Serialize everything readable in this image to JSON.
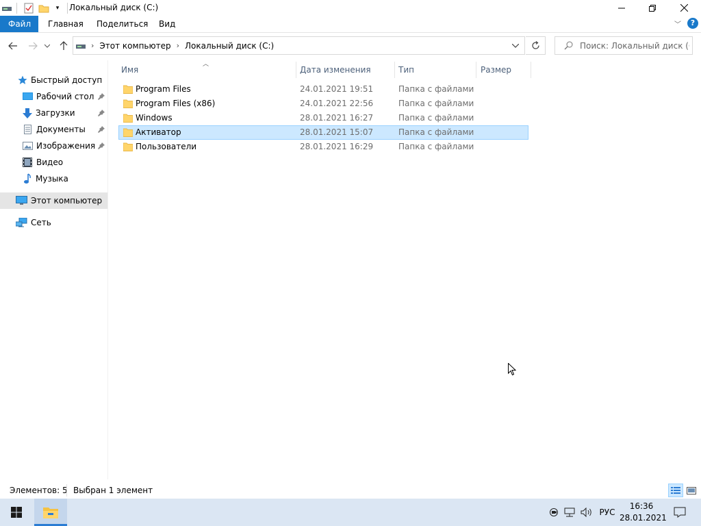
{
  "window": {
    "title": "Локальный диск (C:)",
    "minimize_icon": "minimize-icon",
    "restore_icon": "restore-icon",
    "close_icon": "close-icon"
  },
  "ribbon": {
    "tabs": [
      {
        "label": "Файл",
        "active": true
      },
      {
        "label": "Главная"
      },
      {
        "label": "Поделиться"
      },
      {
        "label": "Вид"
      }
    ],
    "accent": "#1979ca"
  },
  "address": {
    "crumbs": [
      "Этот компьютер",
      "Локальный диск (C:)"
    ]
  },
  "search": {
    "placeholder": "Поиск: Локальный диск (C:)"
  },
  "nav": {
    "items": [
      {
        "label": "Быстрый доступ",
        "icon": "star-icon"
      },
      {
        "label": "Рабочий стол",
        "icon": "desktop-icon",
        "pinned": true
      },
      {
        "label": "Загрузки",
        "icon": "download-icon",
        "pinned": true
      },
      {
        "label": "Документы",
        "icon": "documents-icon",
        "pinned": true
      },
      {
        "label": "Изображения",
        "icon": "pictures-icon",
        "pinned": true
      },
      {
        "label": "Видео",
        "icon": "video-icon"
      },
      {
        "label": "Музыка",
        "icon": "music-icon"
      },
      {
        "label": "Этот компьютер",
        "icon": "computer-icon",
        "selected": true
      },
      {
        "label": "Сеть",
        "icon": "network-icon"
      }
    ]
  },
  "columns": {
    "name": "Имя",
    "date": "Дата изменения",
    "type": "Тип",
    "size": "Размер"
  },
  "files": [
    {
      "name": "Program Files",
      "date": "24.01.2021 19:51",
      "type": "Папка с файлами"
    },
    {
      "name": "Program Files (x86)",
      "date": "24.01.2021 22:56",
      "type": "Папка с файлами"
    },
    {
      "name": "Windows",
      "date": "28.01.2021 16:27",
      "type": "Папка с файлами"
    },
    {
      "name": "Активатор",
      "date": "28.01.2021 15:07",
      "type": "Папка с файлами",
      "selected": true
    },
    {
      "name": "Пользователи",
      "date": "28.01.2021 16:29",
      "type": "Папка с файлами"
    }
  ],
  "status": {
    "count": "Элементов: 5",
    "selection": "Выбран 1 элемент"
  },
  "taskbar": {
    "language": "РУС",
    "time": "16:36",
    "date": "28.01.2021"
  }
}
